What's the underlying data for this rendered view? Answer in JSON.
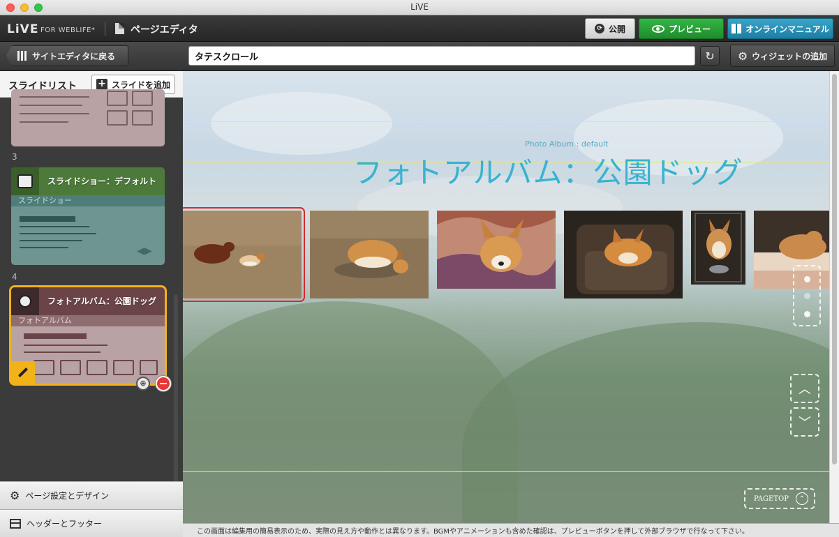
{
  "window": {
    "title": "LiVE"
  },
  "app": {
    "logo": "LiVE",
    "logo_sub": "FOR WEBLIFE*",
    "editor_title": "ページエディタ",
    "publish_label": "公開",
    "preview_label": "プレビュー",
    "manual_label": "オンラインマニュアル"
  },
  "toolbar": {
    "back_label": "サイトエディタに戻る",
    "page_title_value": "タテスクロール",
    "widget_label": "ウィジェットの追加"
  },
  "sidebar": {
    "title": "スライドリスト",
    "add_slide_label": "スライドを追加",
    "slides": [
      {
        "number": "3",
        "title": "スライドショー：デフォルト",
        "subtitle": "スライドショー"
      },
      {
        "number": "4",
        "title": "フォトアルバム：公園ドッグ",
        "subtitle": "フォトアルバム"
      }
    ],
    "footer": {
      "page_settings_label": "ページ設定とデザイン",
      "header_footer_label": "ヘッダーとフッター"
    }
  },
  "canvas": {
    "small_label": "Photo Album : default",
    "heading": "フォトアルバム：公園ドッグ",
    "pagetop_label": "PAGETOP",
    "photos": [
      {
        "name": "dogs-running"
      },
      {
        "name": "corgi-sniffing"
      },
      {
        "name": "corgi-blanket"
      },
      {
        "name": "corgi-sofa"
      },
      {
        "name": "corgi-crate"
      },
      {
        "name": "corgi-bed"
      }
    ]
  },
  "status": {
    "message": "この画面は編集用の簡易表示のため、実際の見え方や動作とは異なります。BGMやアニメーションも含めた確認は、プレビューボタンを押して外部ブラウザで行なって下さい。"
  },
  "colors": {
    "preview_green": "#1d8d2c",
    "manual_teal": "#1c7ea5",
    "heading_blue": "#3ab2d0",
    "slideshow_green": "#4d7a3a",
    "album_maroon": "#6b4448",
    "selected_outline": "#f2b318",
    "delete_red": "#e53935"
  }
}
